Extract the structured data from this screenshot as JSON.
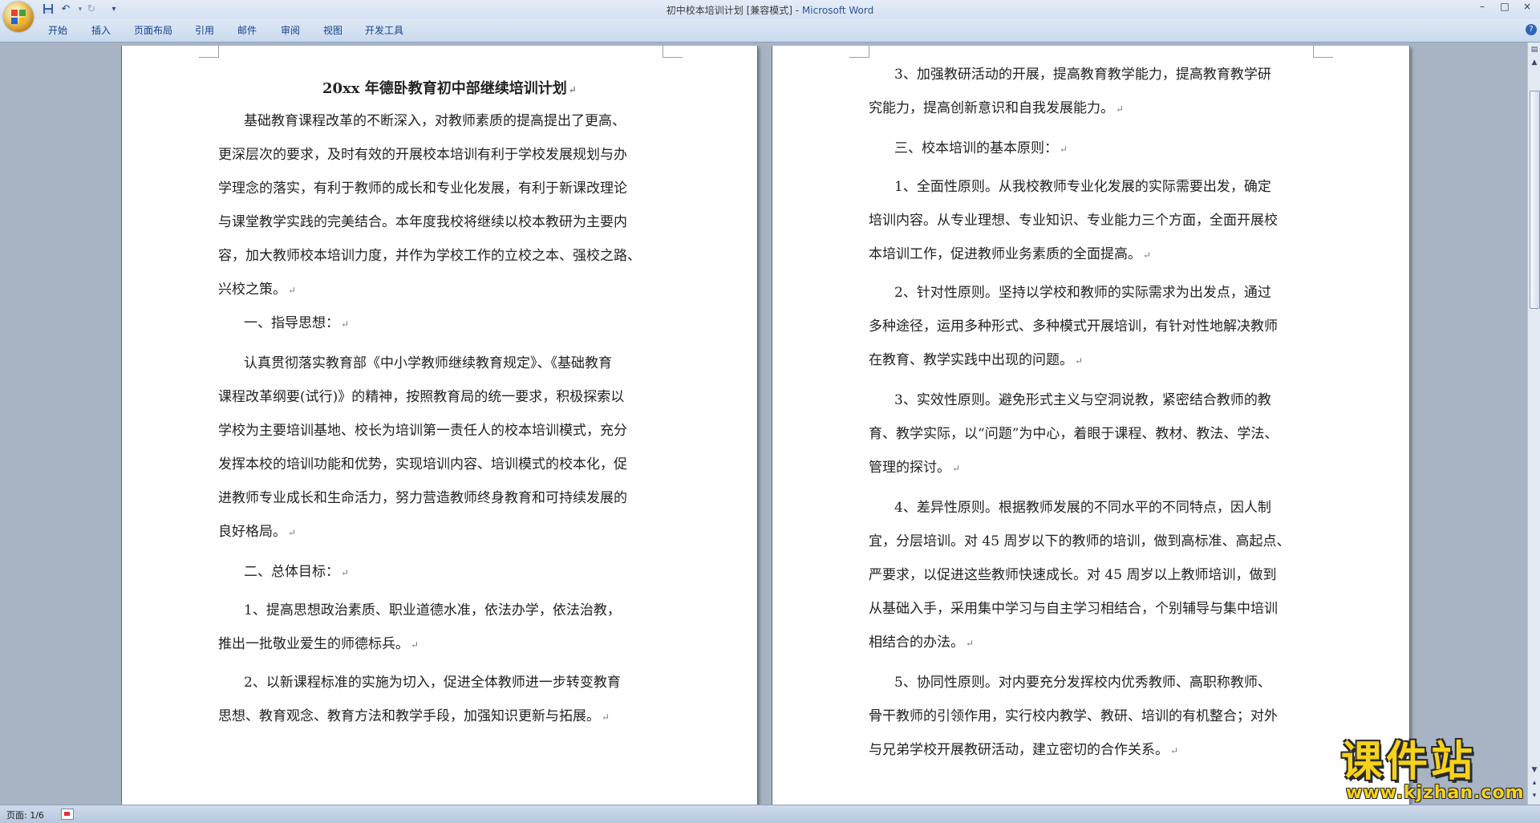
{
  "window": {
    "title": "初中校本培训计划 [兼容模式] - ",
    "app_name": "Microsoft Word",
    "minimize": "–",
    "maximize": "□",
    "close": "×"
  },
  "quick_access": {
    "save_icon": "save-icon",
    "undo": "↶",
    "redo": "↻",
    "more": "▾"
  },
  "ribbon": {
    "tabs": [
      "开始",
      "插入",
      "页面布局",
      "引用",
      "邮件",
      "审阅",
      "视图",
      "开发工具"
    ],
    "help": "?"
  },
  "document": {
    "paragraph_mark": "↵",
    "page1_lines": [
      {
        "text": "20xx 年德卧教育初中部继续培训计划",
        "pm": true
      },
      {
        "text": "基础教育课程改革的不断深入，对教师素质的提高提出了更高、",
        "pm": false
      },
      {
        "text": "更深层次的要求，及时有效的开展校本培训有利于学校发展规划与办",
        "pm": false
      },
      {
        "text": "学理念的落实，有利于教师的成长和专业化发展，有利于新课改理论",
        "pm": false
      },
      {
        "text": "与课堂教学实践的完美结合。本年度我校将继续以校本教研为主要内",
        "pm": false
      },
      {
        "text": "容，加大教师校本培训力度，并作为学校工作的立校之本、强校之路、",
        "pm": false
      },
      {
        "text": "兴校之策。",
        "pm": true
      },
      {
        "text": "一、指导思想：",
        "pm": true
      },
      {
        "text": "认真贯彻落实教育部《中小学教师继续教育规定》、《基础教育",
        "pm": false
      },
      {
        "text": "课程改革纲要(试行)》的精神，按照教育局的统一要求，积极探索以",
        "pm": false
      },
      {
        "text": "学校为主要培训基地、校长为培训第一责任人的校本培训模式，充分",
        "pm": false
      },
      {
        "text": "发挥本校的培训功能和优势，实现培训内容、培训模式的校本化，促",
        "pm": false
      },
      {
        "text": "进教师专业成长和生命活力，努力营造教师终身教育和可持续发展的",
        "pm": false
      },
      {
        "text": "良好格局。",
        "pm": true
      },
      {
        "text": "二、总体目标：",
        "pm": true
      },
      {
        "text": "1、提高思想政治素质、职业道德水准，依法办学，依法治教，",
        "pm": false
      },
      {
        "text": "推出一批敬业爱生的师德标兵。",
        "pm": true
      },
      {
        "text": "2、以新课程标准的实施为切入，促进全体教师进一步转变教育",
        "pm": false
      },
      {
        "text": "思想、教育观念、教育方法和教学手段，加强知识更新与拓展。",
        "pm": true
      }
    ],
    "page2_lines": [
      {
        "text": "3、加强教研活动的开展，提高教育教学能力，提高教育教学研",
        "pm": false
      },
      {
        "text": "究能力，提高创新意识和自我发展能力。",
        "pm": true
      },
      {
        "text": "三、校本培训的基本原则：",
        "pm": true
      },
      {
        "text": "1、全面性原则。从我校教师专业化发展的实际需要出发，确定",
        "pm": false
      },
      {
        "text": "培训内容。从专业理想、专业知识、专业能力三个方面，全面开展校",
        "pm": false
      },
      {
        "text": "本培训工作，促进教师业务素质的全面提高。",
        "pm": true
      },
      {
        "text": "2、针对性原则。坚持以学校和教师的实际需求为出发点，通过",
        "pm": false
      },
      {
        "text": "多种途径，运用多种形式、多种模式开展培训，有针对性地解决教师",
        "pm": false
      },
      {
        "text": "在教育、教学实践中出现的问题。",
        "pm": true
      },
      {
        "text": "3、实效性原则。避免形式主义与空洞说教，紧密结合教师的教",
        "pm": false
      },
      {
        "text": "育、教学实际，以“问题”为中心，着眼于课程、教材、教法、学法、",
        "pm": false
      },
      {
        "text": "管理的探讨。",
        "pm": true
      },
      {
        "text": "4、差异性原则。根据教师发展的不同水平的不同特点，因人制",
        "pm": false
      },
      {
        "text": "宜，分层培训。对 45 周岁以下的教师的培训，做到高标准、高起点、",
        "pm": false
      },
      {
        "text": "严要求，以促进这些教师快速成长。对 45 周岁以上教师培训，做到",
        "pm": false
      },
      {
        "text": "从基础入手，采用集中学习与自主学习相结合，个别辅导与集中培训",
        "pm": false
      },
      {
        "text": "相结合的办法。",
        "pm": true
      },
      {
        "text": "5、协同性原则。对内要充分发挥校内优秀教师、高职称教师、",
        "pm": false
      },
      {
        "text": "骨干教师的引领作用，实行校内教学、教研、培训的有机整合；对外",
        "pm": false
      },
      {
        "text": "与兄弟学校开展教研活动，建立密切的合作关系。",
        "pm": true
      }
    ]
  },
  "statusbar": {
    "page_count": "页面: 1/6"
  },
  "watermark": {
    "main": "课件站",
    "url": "www.kjzhan.com"
  }
}
